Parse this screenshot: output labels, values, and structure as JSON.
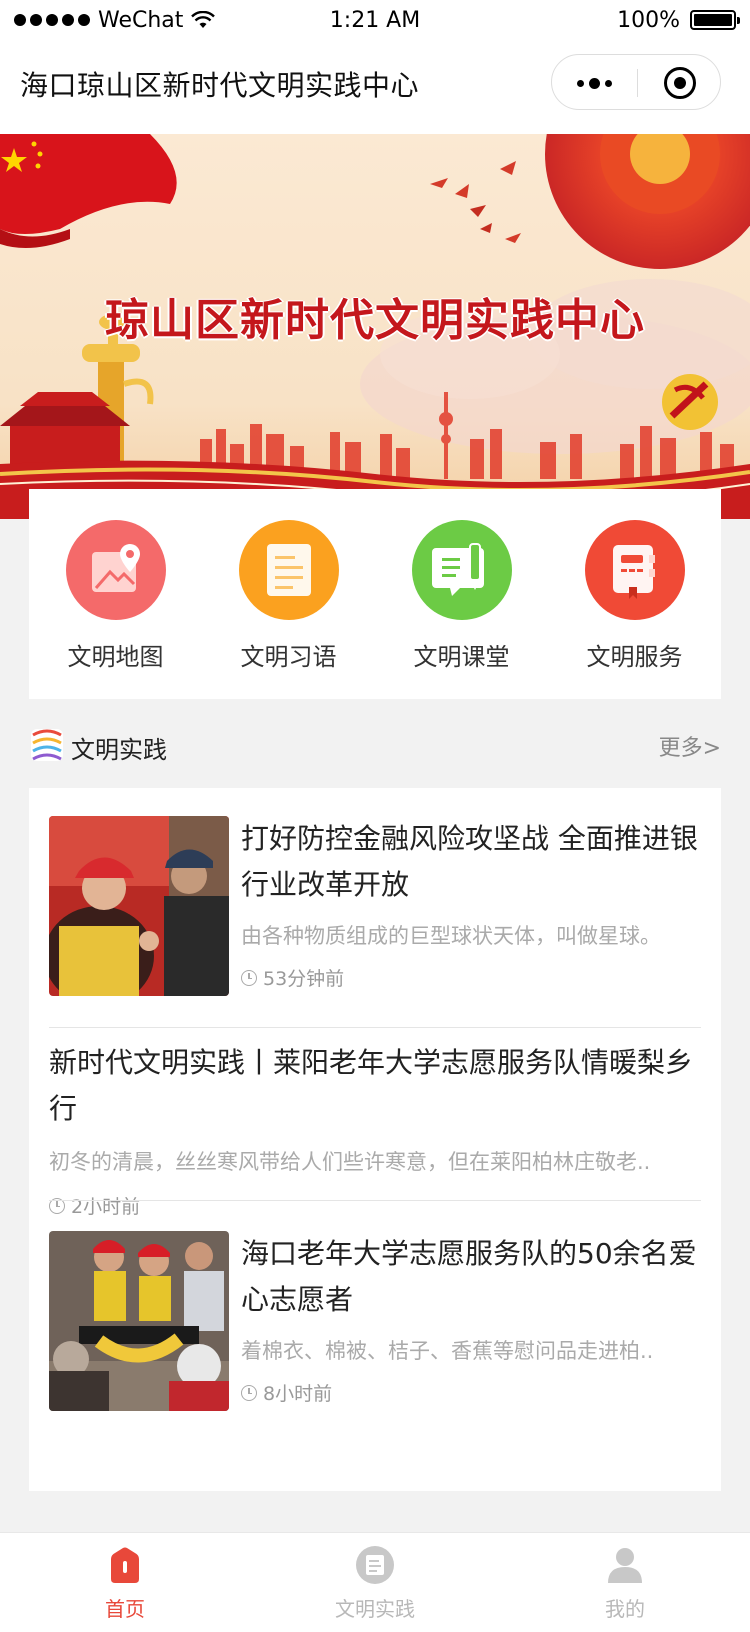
{
  "status_bar": {
    "carrier": "WeChat",
    "time": "1:21 AM",
    "battery": "100%",
    "battery_level": 1.0
  },
  "nav": {
    "title": "海口琼山区新时代文明实践中心",
    "more_icon": "more-dots-icon",
    "close_icon": "close-ring-icon"
  },
  "banner": {
    "title": "琼山区新时代文明实践中心"
  },
  "quick_menu": [
    {
      "label": "文明地图",
      "icon": "map-icon",
      "color": "#f46a6a"
    },
    {
      "label": "文明习语",
      "icon": "document-icon",
      "color": "#fba11f"
    },
    {
      "label": "文明课堂",
      "icon": "classroom-icon",
      "color": "#6ccb45"
    },
    {
      "label": "文明服务",
      "icon": "service-icon",
      "color": "#f04a36"
    }
  ],
  "section": {
    "title": "文明实践",
    "more": "更多>"
  },
  "news": [
    {
      "title": "打好防控金融风险攻坚战 全面推进银行业改革开放",
      "desc": "由各种物质组成的巨型球状天体，叫做星球。",
      "time": "53分钟前",
      "has_thumb": true
    },
    {
      "title": "新时代文明实践丨莱阳老年大学志愿服务队情暖梨乡行",
      "desc": "初冬的清晨，丝丝寒风带给人们些许寒意，但在莱阳柏林庄敬老..",
      "time": "2小时前",
      "has_thumb": false
    },
    {
      "title": "海口老年大学志愿服务队的50余名爱心志愿者",
      "desc": "着棉衣、棉被、桔子、香蕉等慰问品走进柏..",
      "time": "8小时前",
      "has_thumb": true
    }
  ],
  "tabs": [
    {
      "label": "首页",
      "icon": "home-icon",
      "active": true
    },
    {
      "label": "文明实践",
      "icon": "practice-icon",
      "active": false
    },
    {
      "label": "我的",
      "icon": "profile-icon",
      "active": false
    }
  ],
  "colors": {
    "accent": "#e8483a",
    "banner_red": "#c4171c",
    "tab_inactive": "#b8b8b8"
  }
}
